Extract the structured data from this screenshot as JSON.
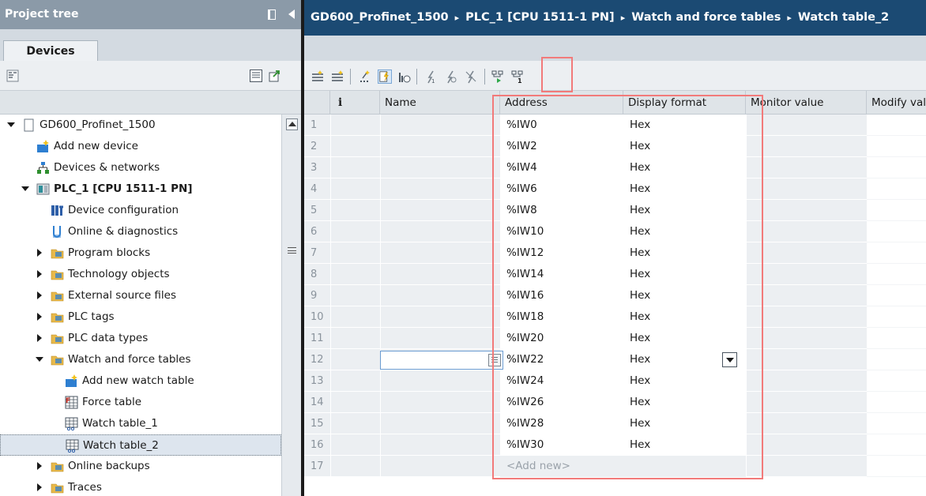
{
  "project_tree": {
    "title": "Project tree",
    "tab": "Devices",
    "items": [
      {
        "label": "GD600_Profinet_1500",
        "level": 0,
        "expander": "open",
        "icon": "project-icon"
      },
      {
        "label": "Add new device",
        "level": 1,
        "expander": "none",
        "icon": "add-device-icon"
      },
      {
        "label": "Devices & networks",
        "level": 1,
        "expander": "none",
        "icon": "network-icon"
      },
      {
        "label": "PLC_1 [CPU 1511-1 PN]",
        "level": 1,
        "expander": "open",
        "icon": "plc-icon",
        "bold": true
      },
      {
        "label": "Device configuration",
        "level": 2,
        "expander": "none",
        "icon": "device-config-icon"
      },
      {
        "label": "Online & diagnostics",
        "level": 2,
        "expander": "none",
        "icon": "diagnostics-icon"
      },
      {
        "label": "Program blocks",
        "level": 2,
        "expander": "closed",
        "icon": "folder-icon"
      },
      {
        "label": "Technology objects",
        "level": 2,
        "expander": "closed",
        "icon": "folder-icon"
      },
      {
        "label": "External source files",
        "level": 2,
        "expander": "closed",
        "icon": "folder-icon"
      },
      {
        "label": "PLC tags",
        "level": 2,
        "expander": "closed",
        "icon": "folder-icon"
      },
      {
        "label": "PLC data types",
        "level": 2,
        "expander": "closed",
        "icon": "folder-icon"
      },
      {
        "label": "Watch and force tables",
        "level": 2,
        "expander": "open",
        "icon": "folder-icon"
      },
      {
        "label": "Add new watch table",
        "level": 3,
        "expander": "none",
        "icon": "add-table-icon"
      },
      {
        "label": "Force table",
        "level": 3,
        "expander": "none",
        "icon": "force-table-icon"
      },
      {
        "label": "Watch table_1",
        "level": 3,
        "expander": "none",
        "icon": "watch-table-icon"
      },
      {
        "label": "Watch table_2",
        "level": 3,
        "expander": "none",
        "icon": "watch-table-icon",
        "selected": true
      },
      {
        "label": "Online backups",
        "level": 2,
        "expander": "closed",
        "icon": "folder-icon"
      },
      {
        "label": "Traces",
        "level": 2,
        "expander": "closed",
        "icon": "folder-icon"
      }
    ]
  },
  "breadcrumb": {
    "parts": [
      "GD600_Profinet_1500",
      "PLC_1 [CPU 1511-1 PN]",
      "Watch and force tables",
      "Watch table_2"
    ],
    "separator": "▸"
  },
  "table": {
    "headers": {
      "info": "i",
      "name": "Name",
      "address": "Address",
      "display_format": "Display format",
      "monitor_value": "Monitor value",
      "modify_value": "Modify value"
    },
    "rows": [
      {
        "num": "1",
        "address": "%IW0",
        "format": "Hex"
      },
      {
        "num": "2",
        "address": "%IW2",
        "format": "Hex"
      },
      {
        "num": "3",
        "address": "%IW4",
        "format": "Hex"
      },
      {
        "num": "4",
        "address": "%IW6",
        "format": "Hex"
      },
      {
        "num": "5",
        "address": "%IW8",
        "format": "Hex"
      },
      {
        "num": "6",
        "address": "%IW10",
        "format": "Hex"
      },
      {
        "num": "7",
        "address": "%IW12",
        "format": "Hex"
      },
      {
        "num": "8",
        "address": "%IW14",
        "format": "Hex"
      },
      {
        "num": "9",
        "address": "%IW16",
        "format": "Hex"
      },
      {
        "num": "10",
        "address": "%IW18",
        "format": "Hex"
      },
      {
        "num": "11",
        "address": "%IW20",
        "format": "Hex"
      },
      {
        "num": "12",
        "address": "%IW22",
        "format": "Hex",
        "editing": true
      },
      {
        "num": "13",
        "address": "%IW24",
        "format": "Hex"
      },
      {
        "num": "14",
        "address": "%IW26",
        "format": "Hex"
      },
      {
        "num": "15",
        "address": "%IW28",
        "format": "Hex"
      },
      {
        "num": "16",
        "address": "%IW30",
        "format": "Hex"
      },
      {
        "num": "17",
        "address": "<Add new>",
        "format": "",
        "add_new": true
      }
    ]
  },
  "colors": {
    "project_tree_header": "#8b9aa8",
    "breadcrumb_bar": "#1b4a73",
    "highlight": "#f27a7a",
    "selection": "#dde5ee"
  }
}
